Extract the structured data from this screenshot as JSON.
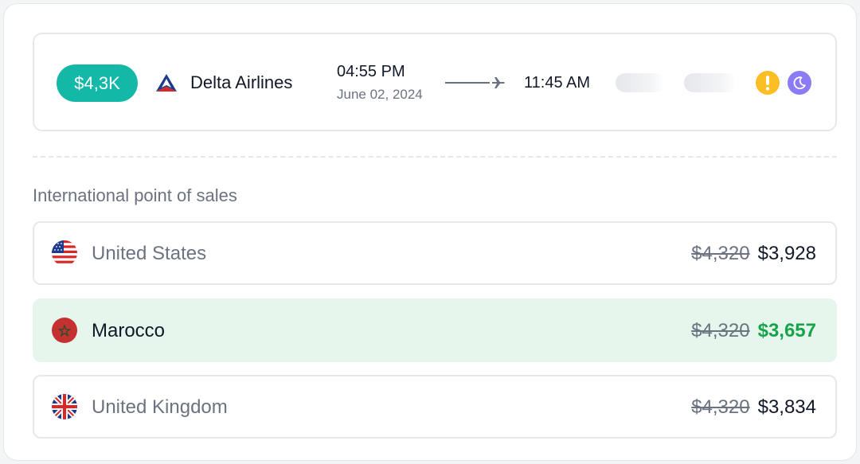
{
  "flight": {
    "price": "$4,3K",
    "airline": "Delta Airlines",
    "departure_time": "04:55 PM",
    "departure_date": "June 02, 2024",
    "arrival_time": "11:45 AM"
  },
  "colors": {
    "accent": "#14b8a6",
    "warning": "#fbbf24",
    "night": "#8b7cf6",
    "discount": "#16a34a",
    "highlight_bg": "#e7f6ec"
  },
  "sales": {
    "title": "International point of sales",
    "rows": [
      {
        "country": "United States",
        "flag": "us-flag-icon",
        "old_price": "$4,320",
        "new_price": "$3,928",
        "highlighted": false
      },
      {
        "country": "Marocco",
        "flag": "morocco-flag-icon",
        "old_price": "$4,320",
        "new_price": "$3,657",
        "highlighted": true
      },
      {
        "country": "United Kingdom",
        "flag": "uk-flag-icon",
        "old_price": "$4,320",
        "new_price": "$3,834",
        "highlighted": false
      }
    ]
  }
}
